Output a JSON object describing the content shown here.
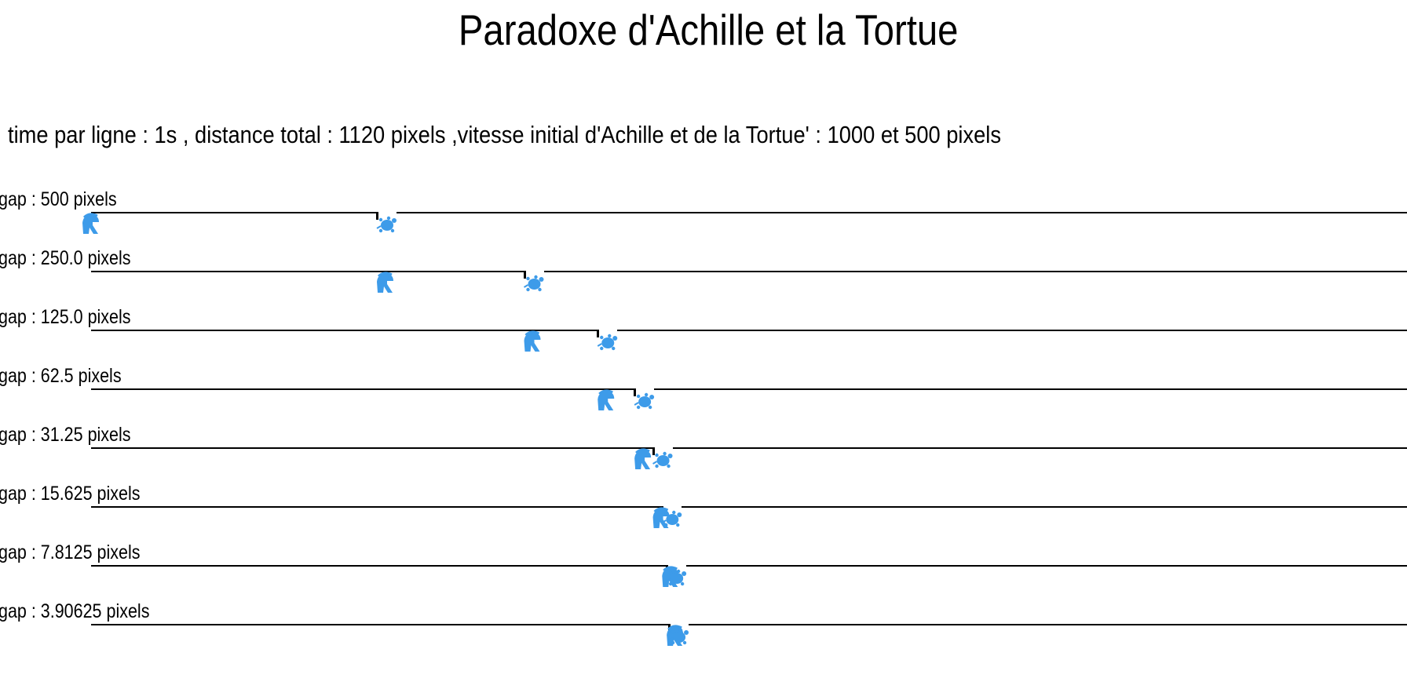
{
  "title": "Paradoxe d'Achille et la Tortue",
  "info": "time par ligne : 1s , distance total : 1120 pixels ,vitesse initial d'Achille et de la Tortue' : 1000 et 500 pixels",
  "distance_total": 1120,
  "runners": {
    "achilles_icon": "spartan-helmet-icon",
    "tortoise_icon": "turtle-icon",
    "icon_color": "#3d9be9"
  },
  "rows": [
    {
      "label": "gap : 500 pixels",
      "achilles": 0,
      "tortoise": 500
    },
    {
      "label": "gap : 250.0 pixels",
      "achilles": 500,
      "tortoise": 750
    },
    {
      "label": "gap : 125.0 pixels",
      "achilles": 750,
      "tortoise": 875
    },
    {
      "label": "gap : 62.5 pixels",
      "achilles": 875,
      "tortoise": 937.5
    },
    {
      "label": "gap : 31.25 pixels",
      "achilles": 937.5,
      "tortoise": 968.75
    },
    {
      "label": "gap : 15.625 pixels",
      "achilles": 968.75,
      "tortoise": 984.375
    },
    {
      "label": "gap : 7.8125 pixels",
      "achilles": 984.375,
      "tortoise": 992.1875
    },
    {
      "label": "gap : 3.90625 pixels",
      "achilles": 992.1875,
      "tortoise": 996.09375
    }
  ]
}
